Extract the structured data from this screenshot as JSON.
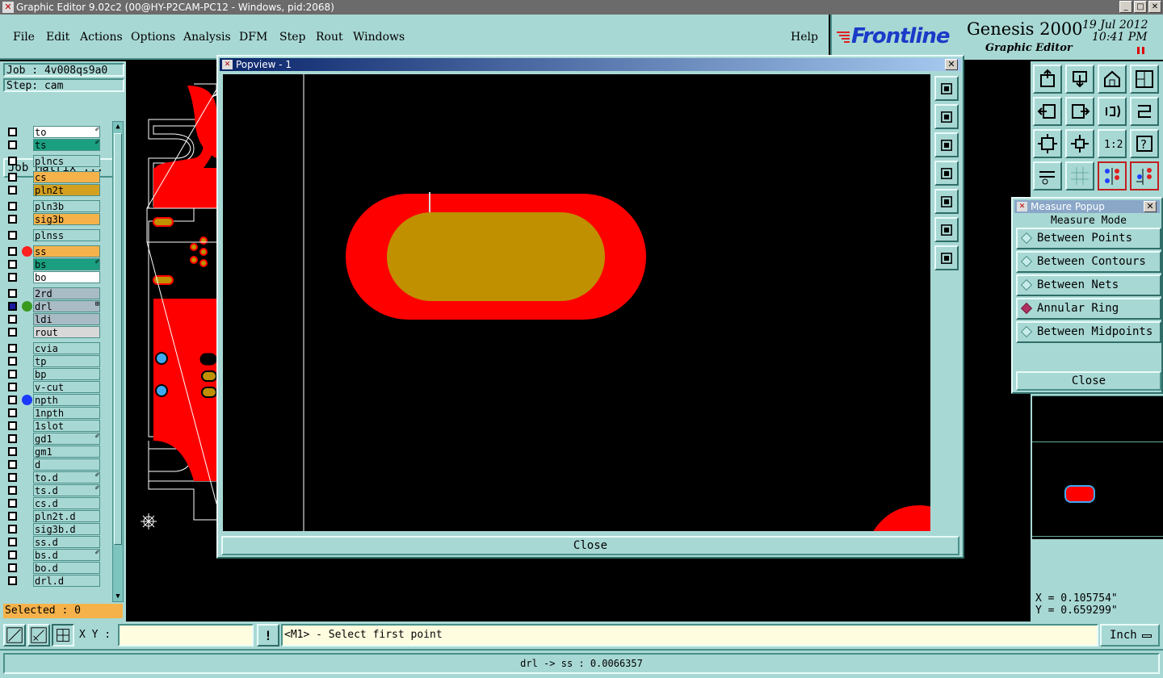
{
  "window": {
    "title": "Graphic Editor 9.02c2 (00@HY-P2CAM-PC12 - Windows, pid:2068)",
    "buttons": [
      "_",
      "□",
      "✕"
    ]
  },
  "menu": {
    "items": [
      "File",
      "Edit",
      "Actions",
      "Options",
      "Analysis",
      "DFM",
      "Step",
      "Rout",
      "Windows"
    ],
    "help": "Help"
  },
  "brand": {
    "logo": "Frontline",
    "product": "Genesis 2000",
    "subtitle": "Graphic Editor",
    "date": "19 Jul 2012",
    "time": "10:41 PM"
  },
  "job": {
    "job_label": "Job : 4v008qs9a0",
    "step_label": "Step: cam",
    "matrix_button": "Job Matrix ..."
  },
  "layers": [
    {
      "name": "to",
      "color": "#ffffff",
      "flag": "✐"
    },
    {
      "name": "ts",
      "color": "#1aa080",
      "flag": "✐"
    },
    {
      "name": "plncs",
      "color": "#a8d8d4",
      "flag": ""
    },
    {
      "name": "cs",
      "color": "#f5b24a",
      "flag": ""
    },
    {
      "name": "pln2t",
      "color": "#d4a020",
      "flag": ""
    },
    {
      "name": "pln3b",
      "color": "#a8d8d4",
      "flag": ""
    },
    {
      "name": "sig3b",
      "color": "#f5b24a",
      "flag": ""
    },
    {
      "name": "plnss",
      "color": "#a8d8d4",
      "flag": ""
    },
    {
      "name": "ss",
      "color": "#f5b24a",
      "flag": "",
      "dot": "#ff2020"
    },
    {
      "name": "bs",
      "color": "#1aa080",
      "flag": "✐"
    },
    {
      "name": "bo",
      "color": "#ffffff",
      "flag": ""
    },
    {
      "name": "2rd",
      "color": "#a9bcc6",
      "flag": ""
    },
    {
      "name": "drl",
      "color": "#a9bcc6",
      "flag": "⊞",
      "dot": "#3a9a20",
      "check": "#1a1aa0"
    },
    {
      "name": "ldi",
      "color": "#a9bcc6",
      "flag": ""
    },
    {
      "name": "rout",
      "color": "#d8d8d8",
      "flag": ""
    },
    {
      "name": "cvia",
      "color": "#a8d8d4",
      "flag": ""
    },
    {
      "name": "tp",
      "color": "#a8d8d4",
      "flag": ""
    },
    {
      "name": "bp",
      "color": "#a8d8d4",
      "flag": ""
    },
    {
      "name": "v-cut",
      "color": "#a8d8d4",
      "flag": ""
    },
    {
      "name": "npth",
      "color": "#a8d8d4",
      "flag": "",
      "dot": "#1a3aff"
    },
    {
      "name": "1npth",
      "color": "#a8d8d4",
      "flag": ""
    },
    {
      "name": "1slot",
      "color": "#a8d8d4",
      "flag": ""
    },
    {
      "name": "gd1",
      "color": "#a8d8d4",
      "flag": "✐"
    },
    {
      "name": "gm1",
      "color": "#a8d8d4",
      "flag": ""
    },
    {
      "name": "d",
      "color": "#a8d8d4",
      "flag": ""
    },
    {
      "name": "to.d",
      "color": "#a8d8d4",
      "flag": "✐"
    },
    {
      "name": "ts.d",
      "color": "#a8d8d4",
      "flag": "✐"
    },
    {
      "name": "cs.d",
      "color": "#a8d8d4",
      "flag": ""
    },
    {
      "name": "pln2t.d",
      "color": "#a8d8d4",
      "flag": ""
    },
    {
      "name": "sig3b.d",
      "color": "#a8d8d4",
      "flag": ""
    },
    {
      "name": "ss.d",
      "color": "#a8d8d4",
      "flag": ""
    },
    {
      "name": "bs.d",
      "color": "#a8d8d4",
      "flag": "✐"
    },
    {
      "name": "bo.d",
      "color": "#a8d8d4",
      "flag": ""
    },
    {
      "name": "drl.d",
      "color": "#a8d8d4",
      "flag": ""
    }
  ],
  "selected": "Selected : 0",
  "popview": {
    "title": "Popview - 1",
    "close_label": "Close"
  },
  "measure": {
    "title": "Measure Popup",
    "mode_label": "Measure Mode",
    "options": [
      {
        "label": "Between Points",
        "selected": false
      },
      {
        "label": "Between Contours",
        "selected": false
      },
      {
        "label": "Between Nets",
        "selected": false
      },
      {
        "label": "Annular Ring",
        "selected": true
      },
      {
        "label": "Between Midpoints",
        "selected": false
      }
    ],
    "close_label": "Close"
  },
  "coords": {
    "x": "X = 0.105754\"",
    "y": "Y = 0.659299\""
  },
  "bottom": {
    "xy_label": "X Y :",
    "xy_value": "",
    "alert": "!",
    "prompt": "<M1> - Select first point",
    "units": "Inch"
  },
  "status": "drl -> ss : 0.0066357",
  "tool_ratio": "1:2",
  "colors": {
    "panel": "#a8d8d4",
    "copper": "#ff0000",
    "pad": "#c09000",
    "drill_blue": "#40a8f0"
  }
}
